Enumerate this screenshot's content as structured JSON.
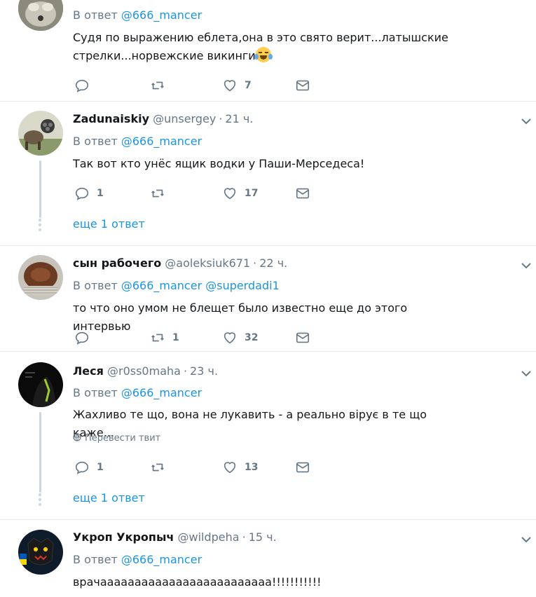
{
  "colors": {
    "link": "#1b95e0",
    "muted": "#657786",
    "text": "#14171a",
    "divider": "#e6ecf0"
  },
  "reply_prefix": "В ответ",
  "translate_label": "Перевести твит",
  "tweets": [
    {
      "reply_to": [
        "@666_mancer"
      ],
      "text": "Судя по выражению еблета,она в это свято верит...латышские стрелки...норвежские викинги",
      "emoji": "face-with-tears-of-joy",
      "replies": "",
      "retweets": "",
      "likes": "7"
    },
    {
      "name": "Zadunaiskiy",
      "handle": "@unsergey",
      "time": "21 ч.",
      "reply_to": [
        "@666_mancer"
      ],
      "text": "Так вот кто унёс ящик водки у Паши-Мерседеса!",
      "replies": "1",
      "retweets": "",
      "likes": "17",
      "more_replies": "еще 1 ответ"
    },
    {
      "name": "сын рабочего",
      "handle": "@aoleksiuk671",
      "time": "22 ч.",
      "reply_to": [
        "@666_mancer",
        "@superdadi1"
      ],
      "text": "то что оно умом не блещет было известно еще до этого интервью",
      "replies": "",
      "retweets": "1",
      "likes": "32"
    },
    {
      "name": "Леся",
      "handle": "@r0ss0maha",
      "time": "23 ч.",
      "reply_to": [
        "@666_mancer"
      ],
      "text": "Жахливо те що, вона не лукавить - а реально вірує в те що каже...",
      "replies": "1",
      "retweets": "",
      "likes": "13",
      "more_replies": "еще 1 ответ"
    },
    {
      "name": "Укроп Укропыч",
      "handle": "@wildpeha",
      "time": "15 ч.",
      "reply_to": [
        "@666_mancer"
      ],
      "text": "врачааааааааааааааааааааааааа!!!!!!!!!!!"
    }
  ]
}
